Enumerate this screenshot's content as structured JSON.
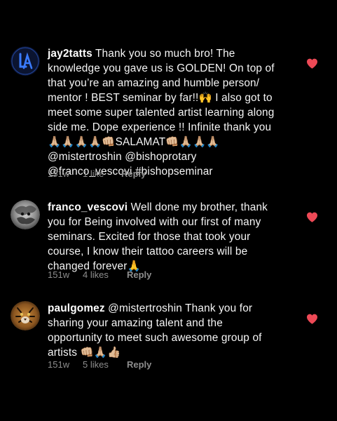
{
  "comments": [
    {
      "username": "jay2tatts",
      "text": "Thank you so much bro! The\nknowledge you gave us is GOLDEN! On top of\nthat you’re an amazing and humble person/\nmentor ! BEST seminar by far!!🙌 I also got to\nmeet some super talented artist learning along\nside me. Dope experience !! Infinite thank you\n🙏🏼🙏🏼🙏🏼🙏🏼👊🏼SALAMAT👊🏼🙏🏼🙏🏼🙏🏼\n@mistertroshin @bishoprotary\n@franco_vescovi #bishopseminar",
      "time": "151w",
      "likes": "1 like",
      "reply": "Reply",
      "avatar_icon": "la-dodgers-logo-icon",
      "liked": true
    },
    {
      "username": "franco_vescovi",
      "text": "Well done my brother, thank\nyou for Being involved with our first of many\nseminars. Excited for those that took your\ncourse, I know their tattoo careers will be\nchanged forever🙏",
      "time": "151w",
      "likes": "4 likes",
      "reply": "Reply",
      "avatar_icon": "user-photo-icon",
      "liked": true
    },
    {
      "username": "paulgomez",
      "text": "@mistertroshin Thank you for\nsharing your amazing talent and the\nopportunity to meet such awesome group of\nartists 👊🏼🙏🏼👍🏼",
      "time": "151w",
      "likes": "5 likes",
      "reply": "Reply",
      "avatar_icon": "tiger-photo-icon",
      "liked": true
    }
  ],
  "colors": {
    "background": "#000000",
    "text": "#f5f5f5",
    "meta": "#8e8e8e",
    "heart": "#ed4956"
  }
}
